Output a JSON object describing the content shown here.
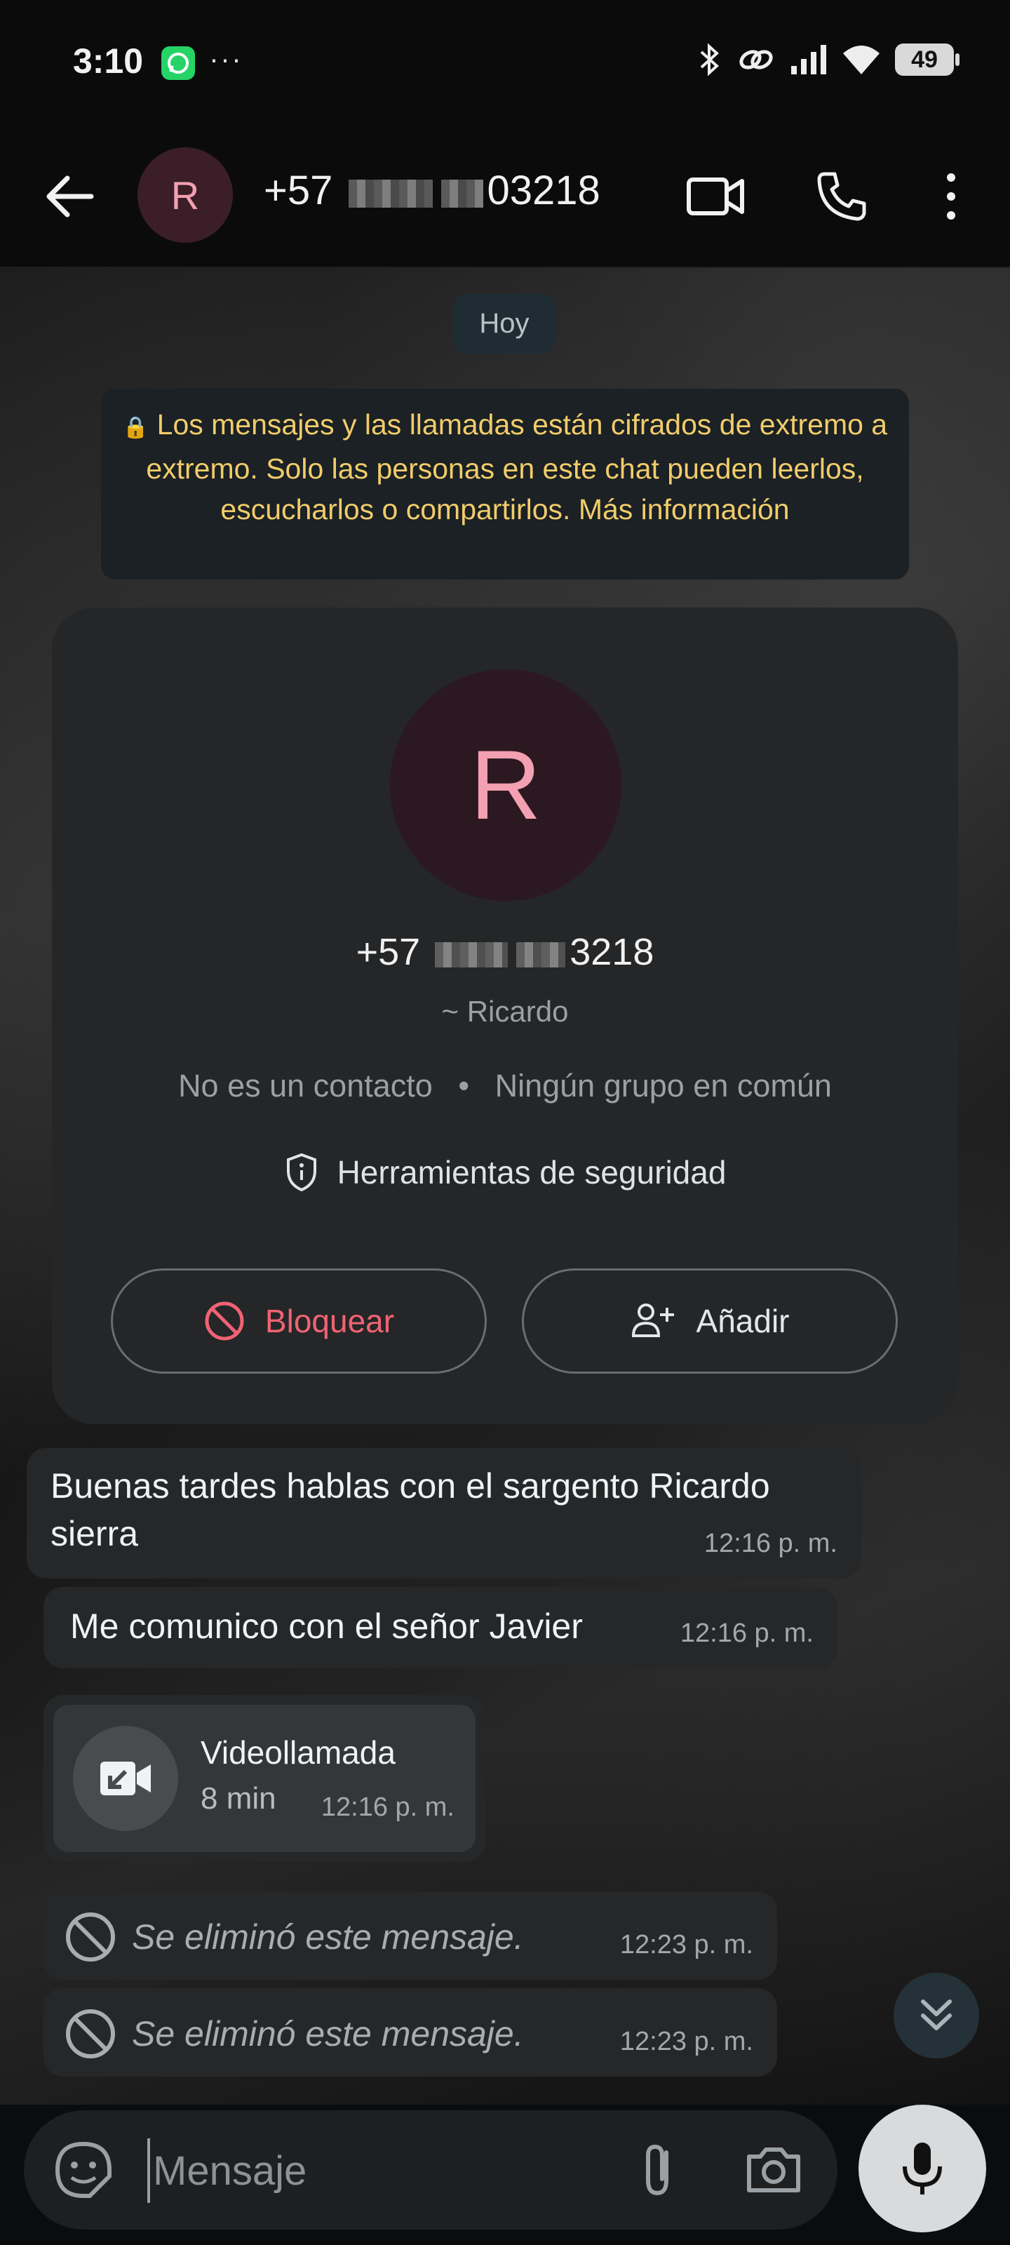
{
  "status_bar": {
    "time": "3:10",
    "battery": "49",
    "icons": [
      "whatsapp-icon",
      "more-dots-icon",
      "bluetooth-icon",
      "link-icon",
      "signal-icon",
      "wifi-icon",
      "battery-icon"
    ]
  },
  "header": {
    "avatar_initial": "R",
    "phone_prefix": "+57",
    "phone_suffix": "03218"
  },
  "date_chip": "Hoy",
  "encryption_notice": {
    "text": "Los mensajes y las llamadas están cifrados de extremo a extremo. Solo las personas en este chat pueden leerlos, escucharlos o compartirlos.",
    "link": "Más información"
  },
  "contact_card": {
    "avatar_initial": "R",
    "phone_prefix": "+57",
    "phone_suffix": "3218",
    "push_name": "~ Ricardo",
    "not_contact": "No es un contacto",
    "separator": "•",
    "groups": "Ningún grupo en común",
    "safety_tools": "Herramientas de seguridad",
    "block_label": "Bloquear",
    "add_label": "Añadir"
  },
  "messages": [
    {
      "text": "Buenas tardes hablas con el sargento Ricardo sierra",
      "time": "12:16 p. m."
    },
    {
      "text": "Me comunico con el señor Javier",
      "time": "12:16 p. m."
    },
    {
      "type": "call",
      "title": "Videollamada",
      "duration": "8 min",
      "time": "12:16 p. m."
    },
    {
      "type": "deleted",
      "text": "Se eliminó este mensaje.",
      "time": "12:23 p. m."
    },
    {
      "type": "deleted",
      "text": "Se eliminó este mensaje.",
      "time": "12:23 p. m."
    }
  ],
  "composer": {
    "placeholder": "Mensaje"
  },
  "colors": {
    "accent_yellow": "#f1cc6b",
    "block_red": "#f06374",
    "avatar_pink": "#f3a0b2",
    "bubble": "#262728"
  }
}
